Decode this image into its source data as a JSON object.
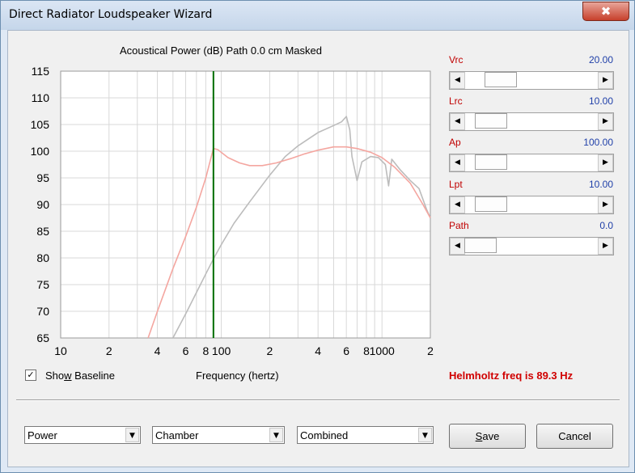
{
  "window": {
    "title": "Direct Radiator Loudspeaker Wizard",
    "close_symbol": "✖"
  },
  "chart_title": "Acoustical Power (dB)   Path 0.0 cm   Masked",
  "params": [
    {
      "label": "Vrc",
      "value": "20.00",
      "thumb_fraction": 0.2
    },
    {
      "label": "Lrc",
      "value": "10.00",
      "thumb_fraction": 0.1
    },
    {
      "label": "Ap",
      "value": "100.00",
      "thumb_fraction": 0.1
    },
    {
      "label": "Lpt",
      "value": "10.00",
      "thumb_fraction": 0.1
    },
    {
      "label": "Path",
      "value": "0.0",
      "thumb_fraction": 0.0
    }
  ],
  "show_baseline": {
    "checked": true,
    "mark": "✓",
    "label_pre": "Sho",
    "label_u": "w",
    "label_post": " Baseline"
  },
  "x_axis_title": "Frequency (hertz)",
  "helmholtz_text": "Helmholtz freq is 89.3 Hz",
  "dropdowns": [
    {
      "value": "Power"
    },
    {
      "value": "Chamber"
    },
    {
      "value": "Combined"
    }
  ],
  "buttons": {
    "save_u": "S",
    "save_rest": "ave",
    "cancel": "Cancel"
  },
  "colors": {
    "combined_curve": "#f4a6a0",
    "baseline_curve": "#bcbcbc",
    "helmholtz_marker": "#007000",
    "grid": "#d8d8d8",
    "accent_red": "#d00000",
    "value_blue": "#1f3fa8"
  },
  "chart_data": {
    "type": "line",
    "title": "Acoustical Power (dB)   Path 0.0 cm   Masked",
    "xlabel": "Frequency (hertz)",
    "ylabel": "",
    "x_scale": "log",
    "xlim": [
      10,
      2000
    ],
    "ylim": [
      65,
      115
    ],
    "yticks": [
      65,
      70,
      75,
      80,
      85,
      90,
      95,
      100,
      105,
      110,
      115
    ],
    "xtick_labels": [
      {
        "value": 10,
        "label": "10"
      },
      {
        "value": 20,
        "label": "2"
      },
      {
        "value": 40,
        "label": "4"
      },
      {
        "value": 60,
        "label": "6"
      },
      {
        "value": 80,
        "label": "8"
      },
      {
        "value": 100,
        "label": "100"
      },
      {
        "value": 200,
        "label": "2"
      },
      {
        "value": 400,
        "label": "4"
      },
      {
        "value": 600,
        "label": "6"
      },
      {
        "value": 800,
        "label": "8"
      },
      {
        "value": 1000,
        "label": "1000"
      },
      {
        "value": 2000,
        "label": "2"
      }
    ],
    "grid": true,
    "vertical_marker_x": 89.3,
    "series": [
      {
        "color": "#f4a6a0",
        "x": [
          35,
          40,
          50,
          60,
          70,
          80,
          89.3,
          95,
          110,
          130,
          150,
          180,
          220,
          270,
          330,
          400,
          500,
          600,
          700,
          850,
          1000,
          1200,
          1500,
          1800,
          2000
        ],
        "y": [
          65,
          70,
          78,
          84,
          89.5,
          95,
          100.5,
          100.3,
          98.8,
          97.8,
          97.3,
          97.3,
          97.8,
          98.6,
          99.5,
          100.2,
          100.8,
          100.8,
          100.5,
          99.8,
          98.8,
          97,
          94,
          90,
          87.5
        ]
      },
      {
        "color": "#bcbcbc",
        "x": [
          50,
          60,
          70,
          80,
          90,
          100,
          120,
          150,
          200,
          250,
          300,
          400,
          500,
          560,
          600,
          630,
          650,
          700,
          750,
          850,
          950,
          1050,
          1100,
          1150,
          1300,
          1500,
          1700,
          1900,
          2000
        ],
        "y": [
          65,
          69.5,
          73.5,
          77,
          80,
          82.5,
          86.5,
          90.5,
          95.5,
          99,
          101,
          103.5,
          104.8,
          105.5,
          106.5,
          104,
          99,
          94.5,
          98,
          99,
          98.8,
          97.5,
          93.5,
          98.5,
          96.5,
          94.5,
          93,
          89,
          87.5
        ]
      }
    ]
  }
}
